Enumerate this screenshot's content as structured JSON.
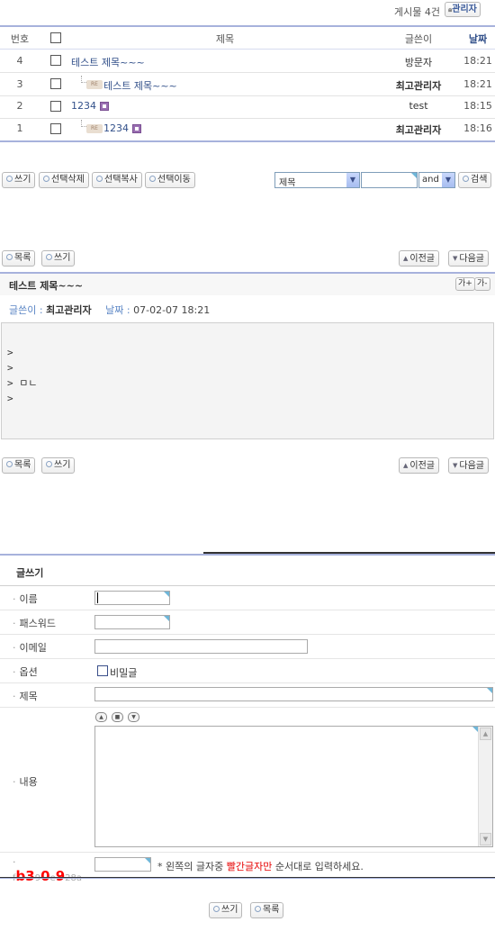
{
  "list": {
    "post_count": "게시물 4건",
    "admin_button": "관리자",
    "headers": {
      "num": "번호",
      "title": "제목",
      "writer": "글쓴이",
      "date": "날짜"
    },
    "rows": [
      {
        "num": "4",
        "title": "테스트 제목~~~",
        "writer": "방문자",
        "date": "18:21"
      },
      {
        "num": "3",
        "re": "RE",
        "title": "테스트 제목~~~",
        "writer": "최고관리자",
        "date": "18:21"
      },
      {
        "num": "2",
        "title": "1234",
        "writer": "test",
        "date": "18:15"
      },
      {
        "num": "1",
        "re": "RE",
        "title": "1234",
        "writer": "최고관리자",
        "date": "18:16"
      }
    ],
    "buttons": {
      "write": "쓰기",
      "delete_selected": "선택삭제",
      "copy_selected": "선택복사",
      "move_selected": "선택이동"
    },
    "search": {
      "field": "제목",
      "value": "",
      "operator": "and",
      "button": "검색"
    }
  },
  "view_top_nav": {
    "list": "목록",
    "write": "쓰기",
    "prev": "이전글",
    "next": "다음글"
  },
  "post": {
    "title": "테스트 제목~~~",
    "font_up": "가+",
    "font_down": "가-",
    "writer_label": "글쓴이 :",
    "writer": "최고관리자",
    "date_label": "날짜 :",
    "date": "07-02-07 18:21",
    "content_lines": [
      ">",
      ">",
      "> ㅁㄴ",
      ">"
    ]
  },
  "view_bottom_nav": {
    "list": "목록",
    "write": "쓰기",
    "prev": "이전글",
    "next": "다음글"
  },
  "form": {
    "heading": "글쓰기",
    "labels": {
      "name": "이름",
      "password": "패스워드",
      "email": "이메일",
      "options": "옵션",
      "subject": "제목",
      "content": "내용"
    },
    "secret_label": "비밀글",
    "captcha": {
      "chars": [
        "f",
        "b",
        "3",
        "9",
        "0",
        "e",
        "9",
        "2",
        "8",
        "a"
      ],
      "hint_prefix": "* 왼쪽의 글자중 ",
      "hint_red": "빨간글자만",
      "hint_suffix": " 순서대로 입력하세요."
    },
    "buttons": {
      "write": "쓰기",
      "list": "목록"
    }
  },
  "colors": {
    "accent_blue": "#32508a",
    "header_line": "#a7b2dc",
    "captcha_red": "#ff0000",
    "hint_red": "#e60000"
  }
}
